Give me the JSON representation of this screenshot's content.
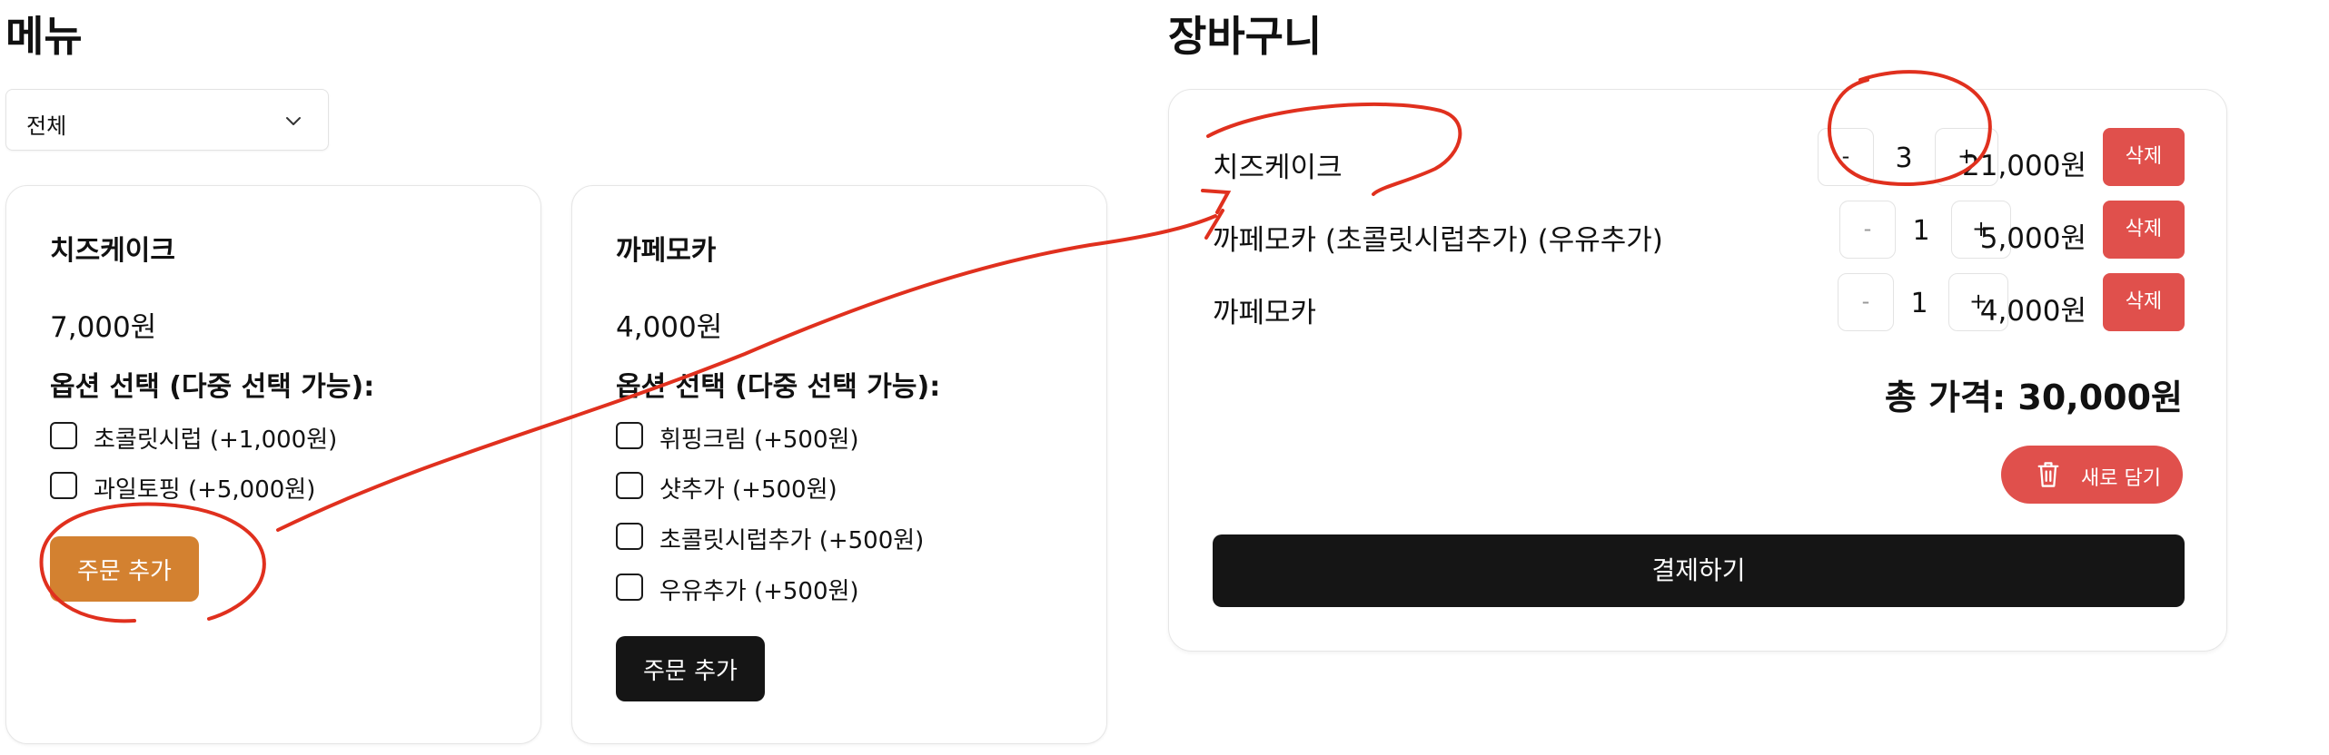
{
  "colors": {
    "primary": "#151515",
    "accent_orange": "#d38130",
    "danger": "#e0504c",
    "annotation": "#e0301e"
  },
  "menu": {
    "title": "메뉴",
    "filter": {
      "selected": "전체",
      "icon": "chevron-down-icon"
    },
    "items": [
      {
        "name": "치즈케이크",
        "price": "7,000원",
        "options_label": "옵션 선택 (다중 선택 가능):",
        "options": [
          "초콜릿시럽 (+1,000원)",
          "과일토핑 (+5,000원)"
        ],
        "button": "주문 추가"
      },
      {
        "name": "까페모카",
        "price": "4,000원",
        "options_label": "옵션 선택 (다중 선택 가능):",
        "options": [
          "휘핑크림 (+500원)",
          "샷추가 (+500원)",
          "초콜릿시럽추가 (+500원)",
          "우유추가 (+500원)"
        ],
        "button": "주문 추가"
      }
    ]
  },
  "cart": {
    "title": "장바구니",
    "items": [
      {
        "name": "치즈케이크",
        "minus": "-",
        "qty": "3",
        "plus": "+",
        "price": "21,000원",
        "delete": "삭제"
      },
      {
        "name": "까페모카 (초콜릿시럽추가) (우유추가)",
        "minus": "-",
        "qty": "1",
        "plus": "+",
        "price": "5,000원",
        "delete": "삭제"
      },
      {
        "name": "까페모카",
        "minus": "-",
        "qty": "1",
        "plus": "+",
        "price": "4,000원",
        "delete": "삭제"
      }
    ],
    "total": "총 가격: 30,000원",
    "reset_button": {
      "label": "새로 담기",
      "icon": "trash-icon"
    },
    "pay_button": "결제하기"
  }
}
